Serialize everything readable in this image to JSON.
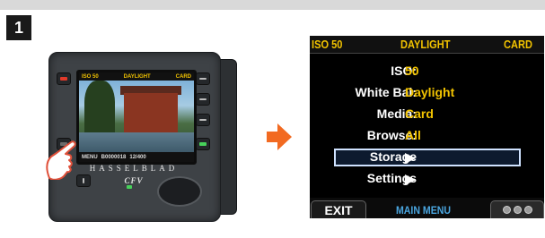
{
  "step": {
    "number": "1"
  },
  "camera": {
    "lcd_top": {
      "iso": "ISO 50",
      "wb": "DAYLIGHT",
      "media": "CARD"
    },
    "lcd_bottom": {
      "menu": "MENU",
      "file": "B0000018",
      "count": "12/400"
    },
    "brand": "HASSELBLAD",
    "model": "CFV"
  },
  "menu_screen": {
    "status_bar": {
      "iso": "ISO 50",
      "white_balance": "DAYLIGHT",
      "media": "CARD"
    },
    "items": [
      {
        "label": "ISO:",
        "value": "50"
      },
      {
        "label": "White Bal:",
        "value": "Daylight"
      },
      {
        "label": "Media:",
        "value": "Card"
      },
      {
        "label": "Browse:",
        "value": "All"
      },
      {
        "label": "Storage",
        "value": "",
        "arrow": true,
        "selected": true
      },
      {
        "label": "Settings",
        "value": "",
        "arrow": true
      }
    ],
    "bottom": {
      "exit": "EXIT",
      "title": "MAIN MENU"
    }
  },
  "colors": {
    "accent": "#f2c300",
    "highlight_border": "#cfe2ff",
    "arrow": "#f26a21",
    "title_blue": "#4aa6e0"
  }
}
